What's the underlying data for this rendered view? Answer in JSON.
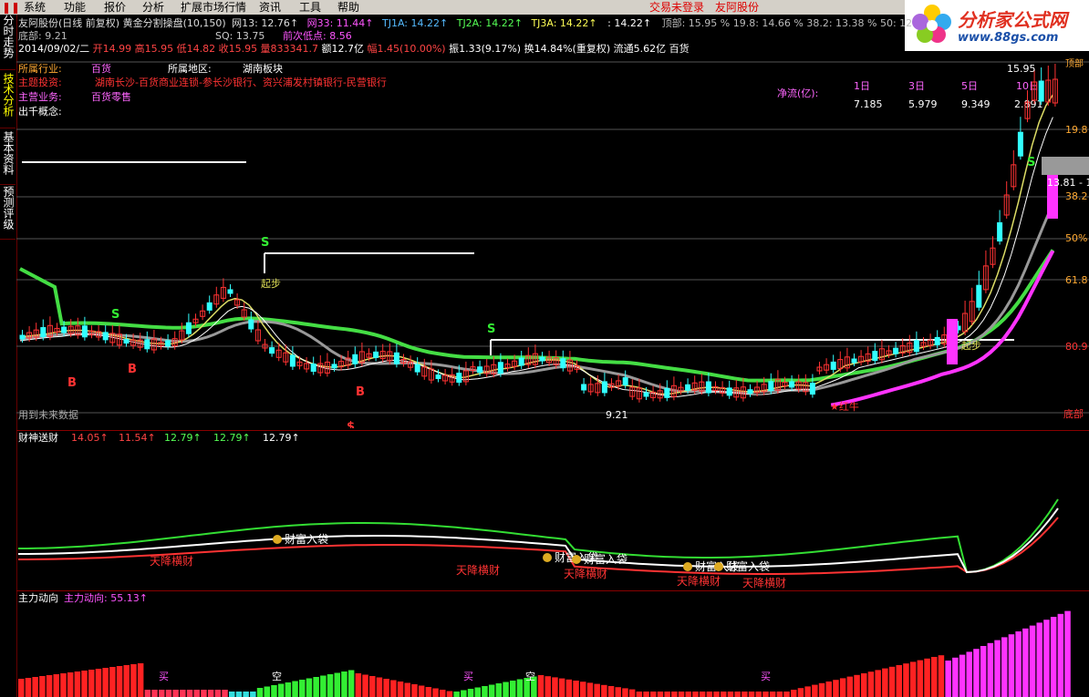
{
  "menu": {
    "items": [
      "系统",
      "功能",
      "报价",
      "分析",
      "扩展市场行情",
      "资讯",
      "工具",
      "帮助"
    ],
    "login_status": "交易未登录",
    "stock_name": "友阿股份"
  },
  "brand": {
    "title": "分析家公式网",
    "url": "www.88gs.com"
  },
  "sidebar": {
    "tabs": [
      "分时走势",
      "技术分析",
      "基本资料",
      "预测评级"
    ]
  },
  "main_header": {
    "row1": [
      {
        "text": "友阿股份(日线 前复权) 黄金分割操盘(10,150)",
        "color": "#dddddd"
      },
      {
        "text": "网13: 12.76↑",
        "color": "#dddddd"
      },
      {
        "text": "网33: 11.44↑",
        "color": "#ff55ff"
      },
      {
        "text": "TJ1A: 14.22↑",
        "color": "#55bbff"
      },
      {
        "text": "TJ2A: 14.22↑",
        "color": "#55ff55"
      },
      {
        "text": "TJ3A: 14.22↑",
        "color": "#ffff55"
      },
      {
        "text": ": 14.22↑",
        "color": "#ffffff"
      },
      {
        "text": "顶部: 15.95 % 19.8: 14.66 % 38.2: 13.38 % 50: 12",
        "color": "#bbbbbb"
      }
    ],
    "row2": [
      {
        "text": "底部: 9.21",
        "color": "#bbbbbb"
      },
      {
        "text": "SQ: 13.75",
        "color": "#ffffff"
      },
      {
        "text": "前次低点: 8.56",
        "color": "#ff55ff"
      }
    ],
    "row3": [
      {
        "text": "2014/09/02/二",
        "color": "#ffffff"
      },
      {
        "text": "开14.99 高15.95 低14.82 收15.95 量833341.7",
        "color": "#ff4444"
      },
      {
        "text": "额12.7亿",
        "color": "#ffffff"
      },
      {
        "text": "幅1.45(10.00%)",
        "color": "#ff4444"
      },
      {
        "text": "振1.33(9.17%) 换14.84%(重复权) 流通5.62亿 百货",
        "color": "#ffffff"
      }
    ]
  },
  "info_box": {
    "industry_label": "所属行业:",
    "industry": "百货",
    "region_label": "所属地区:",
    "region": "湖南板块",
    "shareholding_label": "主题投资:",
    "shareholding": "湖南长沙-百货商业连锁-参长沙银行、资兴浦发村镇银行-民营银行",
    "business_label": "主营业务:",
    "business": "百货零售",
    "concept_label": "出千概念:",
    "netflow_label": "净流(亿):",
    "netflow_cols": [
      "1日",
      "3日",
      "5日",
      "10日"
    ],
    "netflow_vals": [
      "7.185",
      "5.979",
      "9.349",
      "2.891"
    ]
  },
  "price_axis": {
    "labels": [
      "15.95",
      "19.8",
      "38.2",
      "50%",
      "61.8",
      "80.9",
      "底部"
    ],
    "top_label": "顶部",
    "mid_box": "13.81 - 1"
  },
  "annotations": {
    "future_data": "用到未来数据",
    "low_price": "9.21",
    "red_bull": "★红牛",
    "start_step": "起步",
    "start_step2": "起步",
    "buy": "B",
    "sell": "S",
    "dollar": "$"
  },
  "sub1": {
    "title": "财神送财",
    "values": [
      {
        "text": "14.05↑",
        "color": "#ff4444"
      },
      {
        "text": "11.54↑",
        "color": "#ff4444"
      },
      {
        "text": "12.79↑",
        "color": "#55ff55"
      },
      {
        "text": "12.79↑",
        "color": "#55ff55"
      },
      {
        "text": "12.79↑",
        "color": "#ffffff"
      }
    ],
    "wealth_bag": "财富入袋",
    "heaven_wealth": "天降横财"
  },
  "sub2": {
    "title": "主力动向",
    "value_label": "主力动向: 55.13↑",
    "buy": "买",
    "short": "空"
  },
  "colors": {
    "up": "#ff3333",
    "down": "#33ffff",
    "ma_green": "#44dd44",
    "ma_gray": "#999999",
    "ma_magenta": "#ff33ff"
  }
}
